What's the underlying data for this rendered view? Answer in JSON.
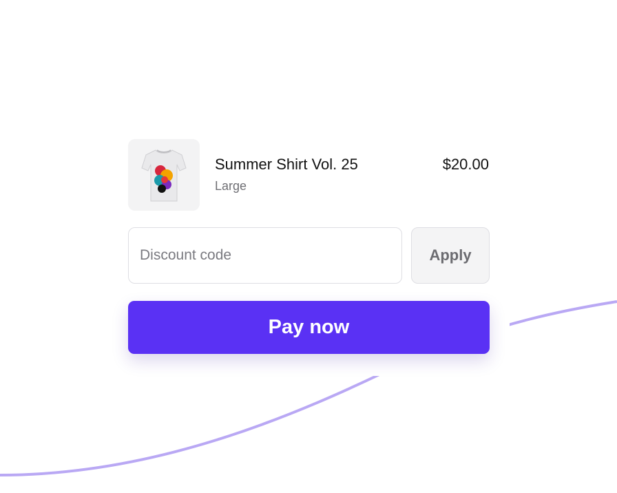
{
  "product": {
    "name": "Summer Shirt Vol. 25",
    "variant": "Large",
    "price": "$20.00",
    "image_icon": "tshirt-icon"
  },
  "discount": {
    "placeholder": "Discount code",
    "apply_label": "Apply"
  },
  "pay_button": {
    "label": "Pay now"
  },
  "colors": {
    "accent": "#5a31f4",
    "curve": "#b9a8f4",
    "thumb_bg": "#f3f3f4"
  }
}
